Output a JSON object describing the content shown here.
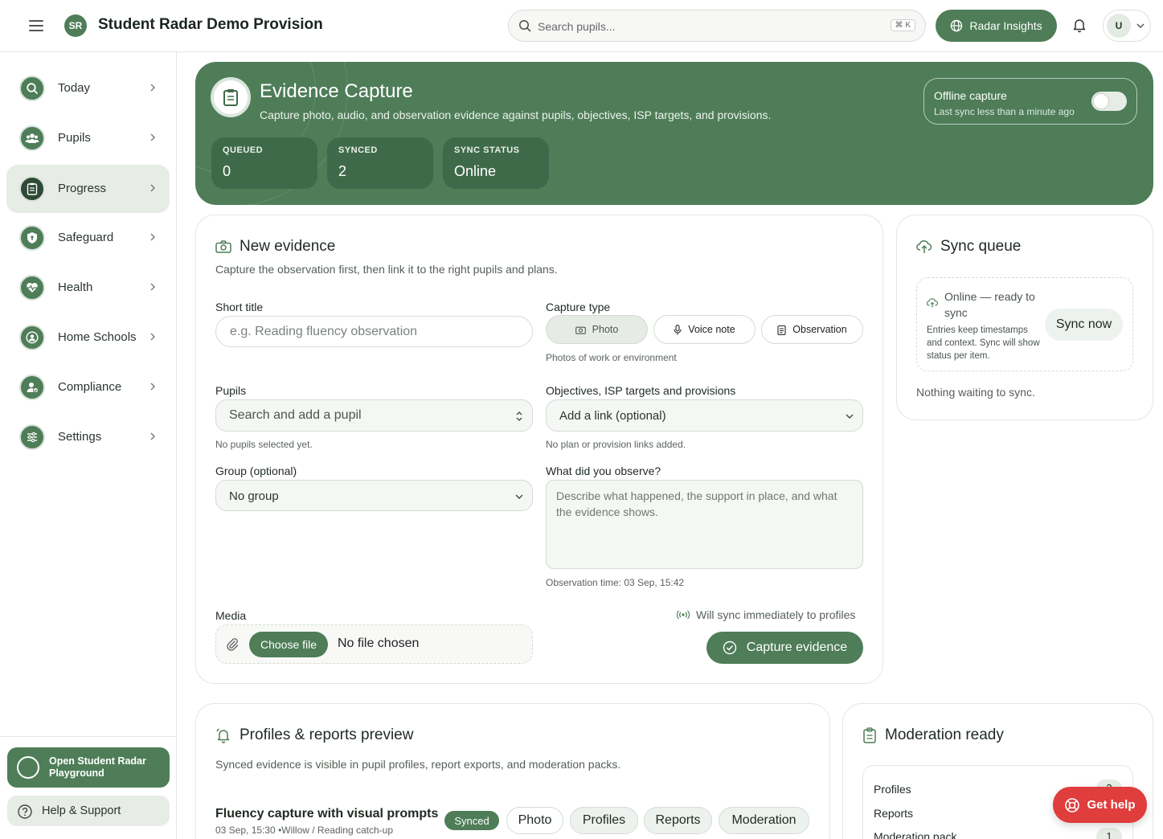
{
  "app": {
    "title": "Student Radar Demo Provision",
    "logo_text": "SR"
  },
  "header": {
    "search_placeholder": "Search pupils...",
    "search_shortcut": "⌘ K",
    "insights_label": "Radar Insights",
    "avatar_initial": "U"
  },
  "sidebar": {
    "items": [
      {
        "label": "Today",
        "icon": "search-icon"
      },
      {
        "label": "Pupils",
        "icon": "users-icon"
      },
      {
        "label": "Progress",
        "icon": "clipboard-icon",
        "active": true
      },
      {
        "label": "Safeguard",
        "icon": "shield-icon"
      },
      {
        "label": "Health",
        "icon": "heart-pulse-icon"
      },
      {
        "label": "Home Schools",
        "icon": "user-circle-icon"
      },
      {
        "label": "Compliance",
        "icon": "user-check-icon"
      },
      {
        "label": "Settings",
        "icon": "sliders-icon"
      }
    ],
    "playground_label": "Open Student Radar Playground",
    "help_label": "Help & Support"
  },
  "hero": {
    "title": "Evidence Capture",
    "subtitle": "Capture photo, audio, and observation evidence against pupils, objectives, ISP targets, and provisions.",
    "stats": [
      {
        "label": "QUEUED",
        "value": "0"
      },
      {
        "label": "SYNCED",
        "value": "2"
      },
      {
        "label": "SYNC STATUS",
        "value": "Online"
      }
    ],
    "offline": {
      "title": "Offline capture",
      "subtitle": "Last sync less than a minute ago",
      "enabled": false
    }
  },
  "new_evidence": {
    "title": "New evidence",
    "description": "Capture the observation first, then link it to the right pupils and plans.",
    "short_title_label": "Short title",
    "short_title_placeholder": "e.g. Reading fluency observation",
    "capture_type_label": "Capture type",
    "capture_types": [
      "Photo",
      "Voice note",
      "Observation"
    ],
    "capture_type_selected": "Photo",
    "capture_type_hint": "Photos of work or environment",
    "pupils_label": "Pupils",
    "pupils_placeholder": "Search and add a pupil",
    "pupils_hint": "No pupils selected yet.",
    "links_label": "Objectives, ISP targets and provisions",
    "links_value": "Add a link (optional)",
    "links_hint": "No plan or provision links added.",
    "group_label": "Group (optional)",
    "group_value": "No group",
    "observe_label": "What did you observe?",
    "observe_placeholder": "Describe what happened, the support in place, and what the evidence shows.",
    "observe_time": "Observation time: 03 Sep, 15:42",
    "media_label": "Media",
    "choose_file_label": "Choose file",
    "no_file_label": "No file chosen",
    "sync_note": "Will sync immediately to profiles",
    "capture_button": "Capture evidence"
  },
  "sync_queue": {
    "title": "Sync queue",
    "status_title": "Online — ready to sync",
    "status_desc": "Entries keep timestamps and context. Sync will show status per item.",
    "sync_now_label": "Sync now",
    "empty_text": "Nothing waiting to sync."
  },
  "profiles_preview": {
    "title": "Profiles & reports preview",
    "description": "Synced evidence is visible in pupil profiles, report exports, and moderation packs.",
    "item": {
      "title": "Fluency capture with visual prompts",
      "meta": "03 Sep, 15:30 •Willow / Reading catch-up",
      "status": "Synced",
      "tags": [
        "Photo",
        "Profiles",
        "Reports",
        "Moderation"
      ]
    }
  },
  "moderation": {
    "title": "Moderation ready",
    "rows": [
      {
        "label": "Profiles",
        "count": "2"
      },
      {
        "label": "Reports",
        "count": ""
      },
      {
        "label": "Moderation pack",
        "count": "1"
      }
    ]
  },
  "get_help_label": "Get help",
  "colors": {
    "brand": "#4e7d58",
    "brand_dark": "#3f6a49",
    "danger": "#e03d3d"
  }
}
